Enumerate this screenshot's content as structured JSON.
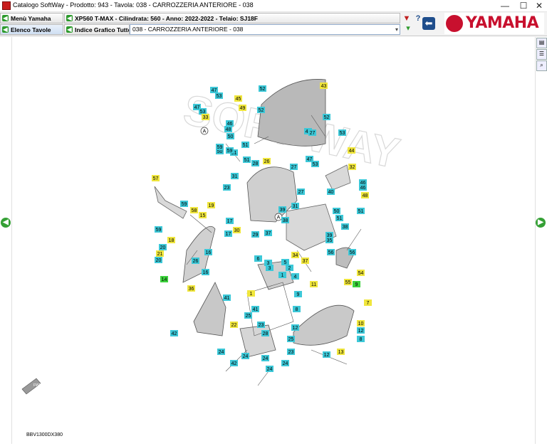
{
  "window": {
    "title": "Catalogo SoftWay - Prodotto: 943 - Tavola: 038 - CARROZZERIA ANTERIORE - 038",
    "controls": {
      "minimize": "—",
      "maximize": "☐",
      "close": "✕"
    }
  },
  "toolbar": {
    "menu_yamaha": "Menù Yamaha",
    "elenco_tavole": "Elenco Tavole",
    "info": "XP560 T-MAX - Cilindrata: 560 - Anno: 2022-2022 - Telaio: SJ18F",
    "indice_grafico": "Indice Grafico Tutte le",
    "table_select": "038 - CARROZZERIA ANTERIORE - 038",
    "filter_icon": "filter-icon",
    "help_label": "?",
    "back_icon": "back-arrow-icon"
  },
  "logo": {
    "text": "YAMAHA"
  },
  "diagram": {
    "reference_code": "BBV1300DX380",
    "watermark": "SOFT WAY",
    "front_label": "FWD",
    "cyan_color": "#3cc8d8",
    "yellow_color": "#f0e63c",
    "green_color": "#3cd23c",
    "callouts": [
      {
        "n": "47",
        "c": "cyan"
      },
      {
        "n": "53",
        "c": "cyan"
      },
      {
        "n": "45",
        "c": "yellow"
      },
      {
        "n": "52",
        "c": "cyan"
      },
      {
        "n": "43",
        "c": "yellow"
      },
      {
        "n": "47",
        "c": "cyan"
      },
      {
        "n": "53",
        "c": "cyan"
      },
      {
        "n": "33",
        "c": "yellow"
      },
      {
        "n": "49",
        "c": "yellow"
      },
      {
        "n": "52",
        "c": "cyan"
      },
      {
        "n": "52",
        "c": "cyan"
      },
      {
        "n": "46",
        "c": "cyan"
      },
      {
        "n": "48",
        "c": "cyan"
      },
      {
        "n": "47",
        "c": "cyan"
      },
      {
        "n": "53",
        "c": "cyan"
      },
      {
        "n": "50",
        "c": "cyan"
      },
      {
        "n": "27",
        "c": "cyan"
      },
      {
        "n": "51",
        "c": "cyan"
      },
      {
        "n": "51",
        "c": "cyan"
      },
      {
        "n": "50",
        "c": "cyan"
      },
      {
        "n": "59",
        "c": "cyan"
      },
      {
        "n": "59",
        "c": "cyan"
      },
      {
        "n": "44",
        "c": "yellow"
      },
      {
        "n": "51",
        "c": "cyan"
      },
      {
        "n": "28",
        "c": "cyan"
      },
      {
        "n": "26",
        "c": "yellow"
      },
      {
        "n": "27",
        "c": "cyan"
      },
      {
        "n": "47",
        "c": "cyan"
      },
      {
        "n": "53",
        "c": "cyan"
      },
      {
        "n": "32",
        "c": "yellow"
      },
      {
        "n": "31",
        "c": "cyan"
      },
      {
        "n": "57",
        "c": "yellow"
      },
      {
        "n": "23",
        "c": "cyan"
      },
      {
        "n": "27",
        "c": "cyan"
      },
      {
        "n": "46",
        "c": "cyan"
      },
      {
        "n": "46",
        "c": "cyan"
      },
      {
        "n": "40",
        "c": "cyan"
      },
      {
        "n": "48",
        "c": "yellow"
      },
      {
        "n": "59",
        "c": "cyan"
      },
      {
        "n": "19",
        "c": "yellow"
      },
      {
        "n": "58",
        "c": "yellow"
      },
      {
        "n": "15",
        "c": "yellow"
      },
      {
        "n": "31",
        "c": "cyan"
      },
      {
        "n": "39",
        "c": "cyan"
      },
      {
        "n": "50",
        "c": "cyan"
      },
      {
        "n": "51",
        "c": "cyan"
      },
      {
        "n": "51",
        "c": "cyan"
      },
      {
        "n": "59",
        "c": "cyan"
      },
      {
        "n": "17",
        "c": "cyan"
      },
      {
        "n": "30",
        "c": "yellow"
      },
      {
        "n": "38",
        "c": "cyan"
      },
      {
        "n": "38",
        "c": "cyan"
      },
      {
        "n": "17",
        "c": "cyan"
      },
      {
        "n": "29",
        "c": "cyan"
      },
      {
        "n": "37",
        "c": "cyan"
      },
      {
        "n": "39",
        "c": "cyan"
      },
      {
        "n": "18",
        "c": "yellow"
      },
      {
        "n": "35",
        "c": "cyan"
      },
      {
        "n": "20",
        "c": "cyan"
      },
      {
        "n": "21",
        "c": "yellow"
      },
      {
        "n": "16",
        "c": "cyan"
      },
      {
        "n": "34",
        "c": "yellow"
      },
      {
        "n": "56",
        "c": "cyan"
      },
      {
        "n": "56",
        "c": "cyan"
      },
      {
        "n": "20",
        "c": "cyan"
      },
      {
        "n": "26",
        "c": "cyan"
      },
      {
        "n": "37",
        "c": "yellow"
      },
      {
        "n": "6",
        "c": "cyan"
      },
      {
        "n": "3",
        "c": "cyan"
      },
      {
        "n": "5",
        "c": "cyan"
      },
      {
        "n": "3",
        "c": "cyan"
      },
      {
        "n": "54",
        "c": "yellow"
      },
      {
        "n": "16",
        "c": "cyan"
      },
      {
        "n": "2",
        "c": "cyan"
      },
      {
        "n": "1",
        "c": "cyan"
      },
      {
        "n": "4",
        "c": "cyan"
      },
      {
        "n": "14",
        "c": "green"
      },
      {
        "n": "1",
        "c": "yellow"
      },
      {
        "n": "55",
        "c": "yellow"
      },
      {
        "n": "11",
        "c": "yellow"
      },
      {
        "n": "36",
        "c": "yellow"
      },
      {
        "n": "9",
        "c": "cyan"
      },
      {
        "n": "8",
        "c": "cyan"
      },
      {
        "n": "41",
        "c": "cyan"
      },
      {
        "n": "41",
        "c": "cyan"
      },
      {
        "n": "25",
        "c": "cyan"
      },
      {
        "n": "7",
        "c": "yellow"
      },
      {
        "n": "42",
        "c": "cyan"
      },
      {
        "n": "22",
        "c": "yellow"
      },
      {
        "n": "23",
        "c": "cyan"
      },
      {
        "n": "10",
        "c": "yellow"
      },
      {
        "n": "12",
        "c": "cyan"
      },
      {
        "n": "12",
        "c": "cyan"
      },
      {
        "n": "8",
        "c": "cyan"
      },
      {
        "n": "13",
        "c": "yellow"
      },
      {
        "n": "12",
        "c": "cyan"
      },
      {
        "n": "25",
        "c": "cyan"
      },
      {
        "n": "28",
        "c": "cyan"
      },
      {
        "n": "24",
        "c": "cyan"
      },
      {
        "n": "23",
        "c": "cyan"
      },
      {
        "n": "24",
        "c": "cyan"
      },
      {
        "n": "24",
        "c": "cyan"
      },
      {
        "n": "42",
        "c": "cyan"
      },
      {
        "n": "24",
        "c": "cyan"
      },
      {
        "n": "24",
        "c": "cyan"
      },
      {
        "n": "9",
        "c": "green"
      }
    ],
    "circle_labels": [
      "A",
      "A"
    ]
  },
  "nav": {
    "prev_icon": "prev-arrow-icon",
    "next_icon": "next-arrow-icon"
  },
  "side_tools": [
    "print-icon",
    "list-icon",
    "zoom-icon"
  ]
}
